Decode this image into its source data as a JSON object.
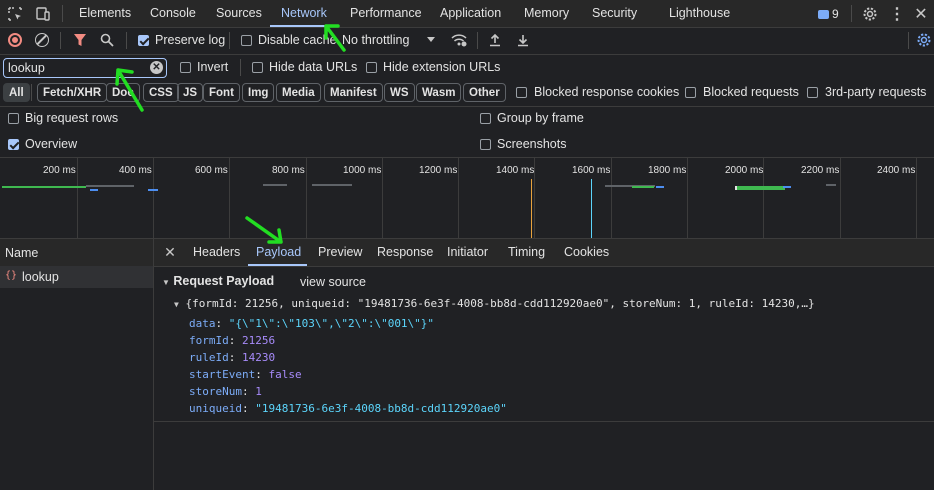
{
  "main_tabs": [
    "Elements",
    "Console",
    "Sources",
    "Network",
    "Performance",
    "Application",
    "Memory",
    "Security",
    "Lighthouse"
  ],
  "active_tab": "Network",
  "issues_count": "9",
  "toolbar": {
    "preserve_log": "Preserve log",
    "disable_cache": "Disable cache",
    "throttling": "No throttling"
  },
  "filter": {
    "value": "lookup",
    "invert": "Invert",
    "hide_data_urls": "Hide data URLs",
    "hide_extension_urls": "Hide extension URLs"
  },
  "type_filters": [
    "All",
    "Fetch/XHR",
    "Doc",
    "CSS",
    "JS",
    "Font",
    "Img",
    "Media",
    "Manifest",
    "WS",
    "Wasm",
    "Other"
  ],
  "extra_filters": {
    "blocked_response_cookies": "Blocked response cookies",
    "blocked_requests": "Blocked requests",
    "third_party": "3rd-party requests"
  },
  "settings": {
    "big_request_rows": "Big request rows",
    "group_by_frame": "Group by frame",
    "overview": "Overview",
    "screenshots": "Screenshots"
  },
  "timeline_ticks": [
    "200 ms",
    "400 ms",
    "600 ms",
    "800 ms",
    "1000 ms",
    "1200 ms",
    "1400 ms",
    "1600 ms",
    "1800 ms",
    "2000 ms",
    "2200 ms",
    "2400 ms"
  ],
  "requests": {
    "column_header": "Name",
    "items": [
      {
        "name": "lookup"
      }
    ]
  },
  "detail_tabs": [
    "Headers",
    "Payload",
    "Preview",
    "Response",
    "Initiator",
    "Timing",
    "Cookies"
  ],
  "active_detail_tab": "Payload",
  "payload": {
    "section_title": "Request Payload",
    "view_source": "view source",
    "summary": "{formId: 21256, uniqueid: \"19481736-6e3f-4008-bb8d-cdd112920ae0\", storeNum: 1, ruleId: 14230,…}",
    "fields": [
      {
        "key": "data",
        "value": "\"{\\\"1\\\":\\\"103\\\",\\\"2\\\":\\\"001\\\"}\"",
        "type": "str"
      },
      {
        "key": "formId",
        "value": "21256",
        "type": "num"
      },
      {
        "key": "ruleId",
        "value": "14230",
        "type": "num"
      },
      {
        "key": "startEvent",
        "value": "false",
        "type": "kw"
      },
      {
        "key": "storeNum",
        "value": "1",
        "type": "num"
      },
      {
        "key": "uniqueid",
        "value": "\"19481736-6e3f-4008-bb8d-cdd112920ae0\"",
        "type": "str"
      }
    ]
  },
  "colors": {
    "accent": "#a8c7fa",
    "annotation_green": "#22dd22",
    "record_red": "#f28b82",
    "filter_red": "#f28b82"
  }
}
